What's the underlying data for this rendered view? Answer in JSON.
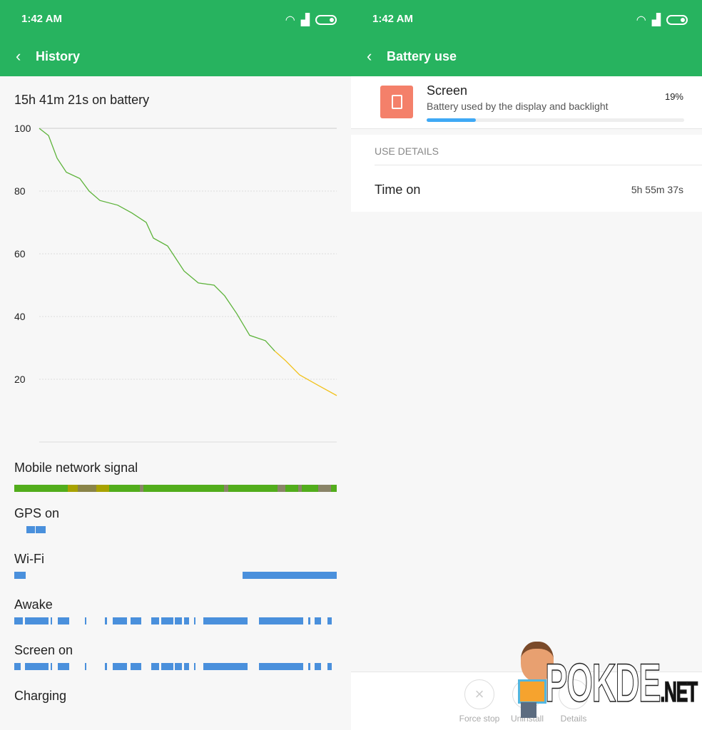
{
  "status": {
    "time": "1:42 AM",
    "icons": [
      "wifi-icon",
      "signal-icon",
      "battery-icon"
    ]
  },
  "left": {
    "title": "History",
    "on_battery": "15h 41m 21s on battery",
    "tracks": [
      {
        "label": "Mobile network signal",
        "segments": [
          {
            "start": 0,
            "end": 2.6,
            "color": "#52ad1c"
          },
          {
            "start": 2.6,
            "end": 3.1,
            "color": "#a8a200"
          },
          {
            "start": 3.1,
            "end": 4.0,
            "color": "#8a8448"
          },
          {
            "start": 4.0,
            "end": 4.6,
            "color": "#a8a200"
          },
          {
            "start": 4.6,
            "end": 6.1,
            "color": "#52ad1c"
          },
          {
            "start": 6.1,
            "end": 6.3,
            "color": "#8a8468"
          },
          {
            "start": 6.3,
            "end": 10.2,
            "color": "#52ad1c"
          },
          {
            "start": 10.2,
            "end": 10.4,
            "color": "#8a8468"
          },
          {
            "start": 10.4,
            "end": 12.8,
            "color": "#52ad1c"
          },
          {
            "start": 12.8,
            "end": 13.2,
            "color": "#8a8468"
          },
          {
            "start": 13.2,
            "end": 13.8,
            "color": "#52ad1c"
          },
          {
            "start": 13.8,
            "end": 14.0,
            "color": "#8a8468"
          },
          {
            "start": 14.0,
            "end": 14.8,
            "color": "#52ad1c"
          },
          {
            "start": 14.8,
            "end": 15.4,
            "color": "#8a8468"
          },
          {
            "start": 15.4,
            "end": 15.69,
            "color": "#52ad1c"
          }
        ]
      },
      {
        "label": "GPS on",
        "segments": [
          {
            "start": 0.59,
            "end": 1.0
          },
          {
            "start": 1.05,
            "end": 1.53
          }
        ]
      },
      {
        "label": "Wi-Fi",
        "segments": [
          {
            "start": 0,
            "end": 0.56
          },
          {
            "start": 11.1,
            "end": 15.69
          }
        ]
      },
      {
        "label": "Awake",
        "segments": [
          {
            "start": 0,
            "end": 0.42
          },
          {
            "start": 0.52,
            "end": 1.67
          },
          {
            "start": 1.77,
            "end": 1.84
          },
          {
            "start": 2.12,
            "end": 2.67
          },
          {
            "start": 3.44,
            "end": 3.51
          },
          {
            "start": 4.41,
            "end": 4.51
          },
          {
            "start": 4.79,
            "end": 5.48
          },
          {
            "start": 5.66,
            "end": 6.18
          },
          {
            "start": 6.66,
            "end": 7.05
          },
          {
            "start": 7.15,
            "end": 7.74
          },
          {
            "start": 7.81,
            "end": 8.16
          },
          {
            "start": 8.26,
            "end": 8.5
          },
          {
            "start": 8.75,
            "end": 8.82
          },
          {
            "start": 9.2,
            "end": 11.35
          },
          {
            "start": 11.91,
            "end": 14.06
          },
          {
            "start": 14.3,
            "end": 14.4
          },
          {
            "start": 14.61,
            "end": 14.92
          },
          {
            "start": 15.24,
            "end": 15.44
          }
        ]
      },
      {
        "label": "Screen on",
        "segments": [
          {
            "start": 0,
            "end": 0.3
          },
          {
            "start": 0.52,
            "end": 1.67
          },
          {
            "start": 1.77,
            "end": 1.84
          },
          {
            "start": 2.12,
            "end": 2.67
          },
          {
            "start": 3.44,
            "end": 3.51
          },
          {
            "start": 4.41,
            "end": 4.51
          },
          {
            "start": 4.79,
            "end": 5.48
          },
          {
            "start": 5.66,
            "end": 6.18
          },
          {
            "start": 6.66,
            "end": 7.05
          },
          {
            "start": 7.15,
            "end": 7.74
          },
          {
            "start": 7.81,
            "end": 8.16
          },
          {
            "start": 8.26,
            "end": 8.5
          },
          {
            "start": 8.75,
            "end": 8.82
          },
          {
            "start": 9.2,
            "end": 11.35
          },
          {
            "start": 11.91,
            "end": 14.06
          },
          {
            "start": 14.3,
            "end": 14.4
          },
          {
            "start": 14.61,
            "end": 14.92
          },
          {
            "start": 15.24,
            "end": 15.44
          }
        ]
      },
      {
        "label": "Charging",
        "segments": []
      }
    ],
    "track_color": "#4a90dc"
  },
  "chart_data": {
    "type": "line",
    "xlim": [
      0,
      15.69
    ],
    "ylim": [
      0,
      100
    ],
    "yticks": [
      "100",
      "80",
      "60",
      "40",
      "20"
    ],
    "grid": true,
    "colors": {
      "normal": "#5db33a",
      "low": "#f2c21c"
    },
    "low_from": 12.42,
    "x": [
      0,
      0.49,
      0.94,
      1.43,
      2.14,
      2.63,
      3.2,
      4.14,
      4.89,
      5.64,
      6.02,
      6.77,
      7.15,
      7.64,
      8.39,
      9.22,
      9.78,
      10.42,
      11.1,
      11.93,
      12.42,
      12.98,
      13.73,
      14.67,
      15.69
    ],
    "y": [
      100,
      97.7,
      90.5,
      86,
      84,
      80,
      77,
      75.5,
      73,
      70,
      65,
      62.5,
      59,
      54.5,
      50.7,
      50,
      46.6,
      40.9,
      34,
      32.3,
      29,
      26,
      21.4,
      18.2,
      14.8
    ]
  },
  "right": {
    "title": "Battery use",
    "app": {
      "name": "Screen",
      "desc": "Battery used by the display and backlight",
      "percent": "19%",
      "usage_fraction": 0.19,
      "bar_color": "#3fa9f5",
      "icon_color": "#f4806a"
    },
    "section": "USE DETAILS",
    "rows": [
      {
        "label": "Time on",
        "value": "5h 55m 37s"
      }
    ],
    "actions": [
      {
        "label": "Force stop"
      },
      {
        "label": "Uninstall"
      },
      {
        "label": "Details"
      }
    ],
    "watermark": "POKDE.NET"
  }
}
